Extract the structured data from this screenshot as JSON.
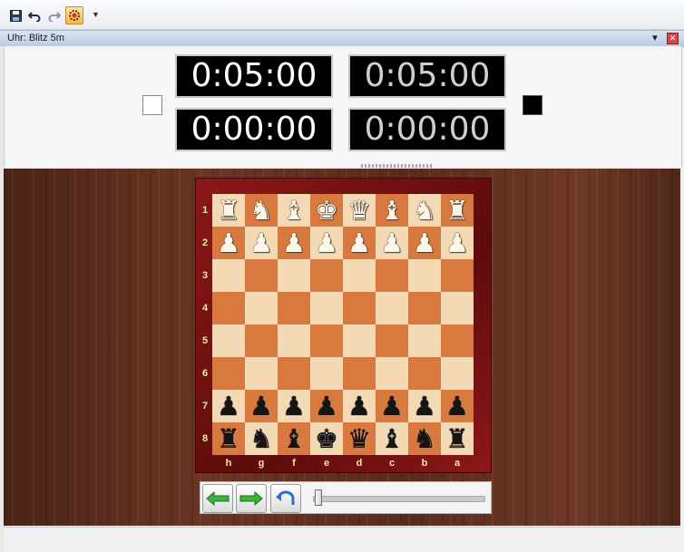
{
  "toolbar": {
    "buttons": [
      {
        "icon": "save-icon"
      },
      {
        "icon": "undo-icon"
      },
      {
        "icon": "redo-icon"
      },
      {
        "icon": "engine-icon"
      }
    ],
    "overflow_icon": "chevron-down-icon"
  },
  "pane": {
    "title": "Uhr: Blitz 5m"
  },
  "clock": {
    "white_main": "0:05:00",
    "white_sub": "0:00:00",
    "black_main": "0:05:00",
    "black_sub": "0:00:00",
    "white_color": "#ffffff",
    "black_color": "#000000"
  },
  "board": {
    "orientation": "black-bottom",
    "ranks": [
      "1",
      "2",
      "3",
      "4",
      "5",
      "6",
      "7",
      "8"
    ],
    "files": [
      "h",
      "g",
      "f",
      "e",
      "d",
      "c",
      "b",
      "a"
    ],
    "rows": [
      [
        "wR",
        "wN",
        "wB",
        "wK",
        "wQ",
        "wB",
        "wN",
        "wR"
      ],
      [
        "wP",
        "wP",
        "wP",
        "wP",
        "wP",
        "wP",
        "wP",
        "wP"
      ],
      [
        "",
        "",
        "",
        "",
        "",
        "",
        "",
        ""
      ],
      [
        "",
        "",
        "",
        "",
        "",
        "",
        "",
        ""
      ],
      [
        "",
        "",
        "",
        "",
        "",
        "",
        "",
        ""
      ],
      [
        "",
        "",
        "",
        "",
        "",
        "",
        "",
        ""
      ],
      [
        "bP",
        "bP",
        "bP",
        "bP",
        "bP",
        "bP",
        "bP",
        "bP"
      ],
      [
        "bR",
        "bN",
        "bB",
        "bK",
        "bQ",
        "bB",
        "bN",
        "bR"
      ]
    ],
    "light_color": "#f3d9b4",
    "dark_color": "#d87a3f",
    "frame_color": "#8c1818"
  },
  "navigation": {
    "back_icon": "arrow-left-icon",
    "forward_icon": "arrow-right-icon",
    "takeback_icon": "undo-arrow-icon",
    "move_position": 0
  }
}
